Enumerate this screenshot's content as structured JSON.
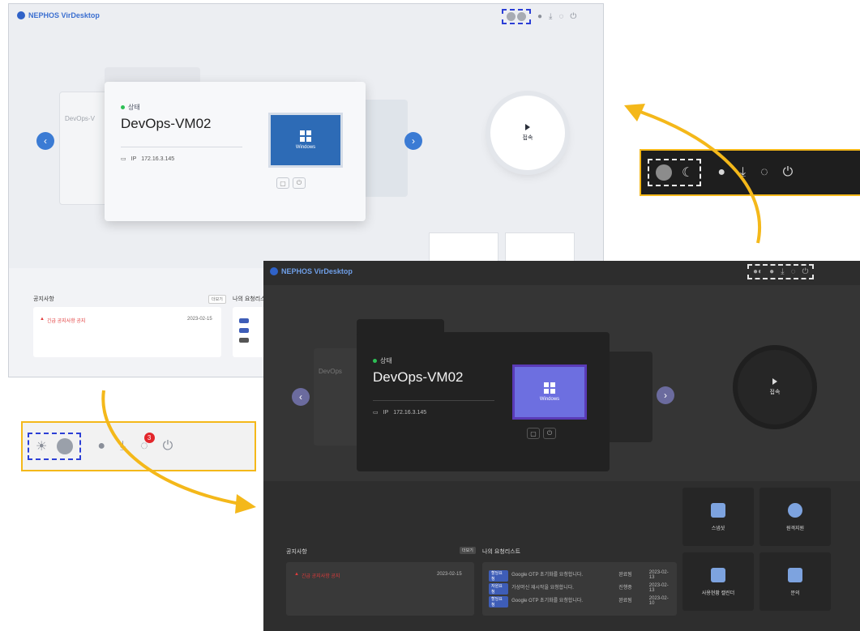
{
  "light_screen": {
    "brand": "NEPHOS VirDesktop",
    "vm": {
      "status": "상태",
      "name": "DevOps-VM02",
      "ip_label": "IP",
      "ip": "172.16.3.145",
      "os": "Windows"
    },
    "back_card_name": "DevOps-V",
    "connect": "접속",
    "notice_title": "공지사항",
    "more": "더보기",
    "request_title": "나의 요청리스트",
    "notice_item": "긴급 공지사항 공지",
    "notice_date": "2023-02-15"
  },
  "dark_screen": {
    "brand": "NEPHOS VirDesktop",
    "vm": {
      "status": "상태",
      "name": "DevOps-VM02",
      "ip_label": "IP",
      "ip": "172.16.3.145",
      "os": "Windows"
    },
    "back_card_name": "DevOps",
    "connect": "접속",
    "notice_title": "공지사항",
    "more": "더보기",
    "request_title": "나의 요청리스트",
    "notice_item": "긴급 공지사항 공지",
    "notice_date": "2023-02-15",
    "requests": [
      {
        "badge": "할당요청",
        "text": "Google OTP 초기화를 요청합니다.",
        "status": "완료됨",
        "date": "2023-02-13"
      },
      {
        "badge": "자원요청",
        "text": "가상머신 재시작을 요청합니다.",
        "status": "진행중",
        "date": "2023-02-13"
      },
      {
        "badge": "할당요청",
        "text": "Google OTP 초기화를 요청합니다.",
        "status": "완료됨",
        "date": "2023-02-10"
      }
    ],
    "tiles": [
      "스냅샷",
      "원격지원",
      "사용현황 캘린더",
      "문의"
    ]
  },
  "zoom_light": {
    "badge_count": "3"
  },
  "colors": {
    "accent_blue": "#2c3fd6",
    "callout_yellow": "#f4b81a",
    "dark_bg": "#353535",
    "light_bg": "#eceef2"
  }
}
